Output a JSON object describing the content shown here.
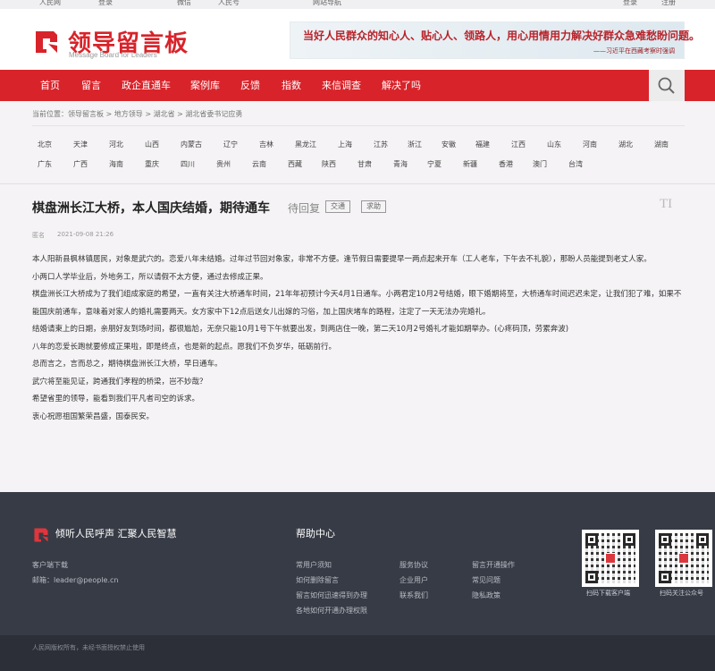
{
  "topbar": {
    "links": [
      "人民网",
      "登录",
      "微信",
      "人民号",
      "网站导航"
    ],
    "right": [
      "登录",
      "注册"
    ]
  },
  "header": {
    "logo_cn": "领导留言板",
    "logo_en": "Message Board for Leaders",
    "banner_main": "当好人民群众的知心人、贴心人、领路人，用心用情用力解决好群众急难愁盼问题。",
    "banner_sub": "——习近平在西藏考察时强调"
  },
  "nav": {
    "items": [
      "首页",
      "留言",
      "政企直通车",
      "案例库",
      "反馈",
      "指数",
      "来信调查",
      "解决了吗"
    ]
  },
  "breadcrumb": "当前位置：领导留言板 > 地方领导 > 湖北省 > 湖北省委书记应勇",
  "regions": {
    "row1": [
      "北京",
      "天津",
      "河北",
      "山西",
      "内蒙古",
      "辽宁",
      "吉林",
      "黑龙江",
      "上海",
      "江苏",
      "浙江",
      "安徽",
      "福建",
      "江西",
      "山东",
      "河南",
      "湖北",
      "湖南"
    ],
    "row2": [
      "广东",
      "广西",
      "海南",
      "重庆",
      "四川",
      "贵州",
      "云南",
      "西藏",
      "陕西",
      "甘肃",
      "青海",
      "宁夏",
      "新疆",
      "香港",
      "澳门",
      "台湾"
    ]
  },
  "post": {
    "title": "棋盘洲长江大桥，本人国庆结婚，期待通车",
    "status": "待回复",
    "tags": [
      "交通",
      "求助"
    ],
    "author": "匿名",
    "date": "2021-09-08 21:26",
    "paragraphs": [
      "本人阳新县枫林镇居民，对象是武穴的。恋爱八年未结婚。过年过节回对象家，非常不方便。逢节假日需要提早一两点起来开车（工人老车，下午去不礼貌），那盼人员能提到老丈人家。",
      "小两口人学毕业后，外地务工，所以请假不太方便，通过去修成正果。",
      "棋盘洲长江大桥成为了我们组成家庭的希望，一直有关注大桥通车时间，21年年初预计今天4月1日通车。小两君定10月2号结婚，眼下婚期将至，大桥通车时间迟迟未定，让我们犯了难，如果不能国庆前通车，意味着对家人的婚礼需要两天。女方家中下12点后送女儿出嫁的习俗，加上国庆堵车的路程，注定了一天无法办完婚礼。",
      "结婚请柬上的日期，亲朋好友到场时间，都很尴尬，无奈只能10月1号下午就要出发，到两店住一晚，第二天10月2号婚礼才能如期举办。(心疼码顶，劳累奔波)",
      "八年的恋爱长跑就要修成正果啦，即是终点，也是新的起点。愿我们不负岁华，砥砺前行。",
      "总而言之，言而总之，期待棋盘洲长江大桥，早日通车。",
      "武穴将至能见证，跨通我们孝程的桥梁，岂不妙哉？",
      "希望省里的领导，能看到我们平凡者司空的诉求。",
      "衷心祝愿祖国繁荣昌盛，国泰民安。"
    ]
  },
  "footer": {
    "slogan": "倾听人民呼声 汇聚人民智慧",
    "app_download": "客户端下载",
    "email": "邮箱：leader@people.cn",
    "help_title": "帮助中心",
    "links_col1": [
      "常用户须知",
      "如何删除留言",
      "留言如何迅速得到办理",
      "各地如何开通办理权限"
    ],
    "links_col2": [
      "服务协议",
      "企业用户",
      "联系我们"
    ],
    "links_col3": [
      "留言开通操作",
      "常见问题",
      "隐私政策"
    ],
    "qr_captions": [
      "扫码下载客户端",
      "扫码关注公众号"
    ],
    "copyright": "人民网版权所有，未经书面授权禁止使用"
  }
}
